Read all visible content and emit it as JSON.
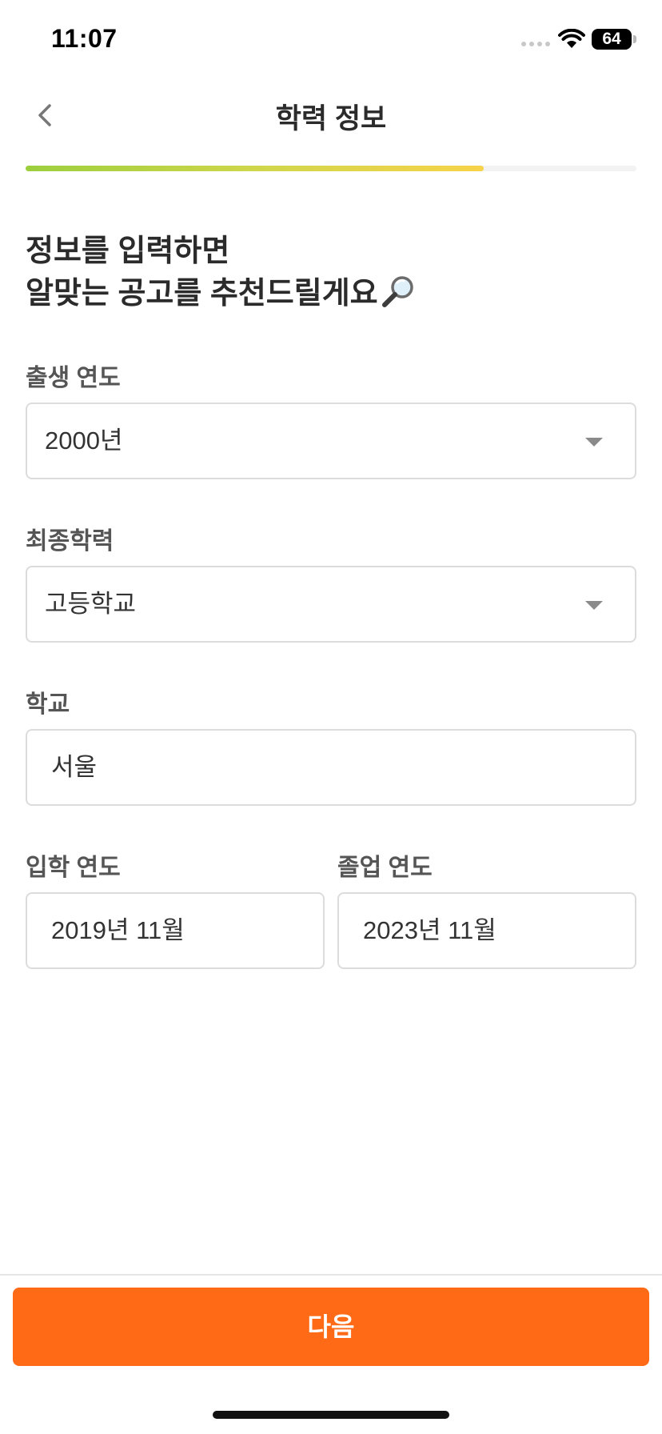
{
  "status_bar": {
    "time": "11:07",
    "battery": "64",
    "icons": [
      "signal-dots-icon",
      "wifi-icon",
      "battery-icon"
    ]
  },
  "nav": {
    "title": "학력 정보",
    "back_icon": "chevron-left-icon"
  },
  "progress": {
    "fraction": 0.75,
    "colors": [
      "#9ccf3d",
      "#f7d349"
    ]
  },
  "heading": {
    "line1": "정보를 입력하면",
    "line2": "알맞는 공고를 추천드릴게요",
    "emoji_icon": "magnifying-glass-icon"
  },
  "form": {
    "birth_year": {
      "label": "출생 연도",
      "value": "2000년"
    },
    "education": {
      "label": "최종학력",
      "value": "고등학교"
    },
    "school": {
      "label": "학교",
      "value": "서울"
    },
    "admission": {
      "label": "입학 연도",
      "value": "2019년 11월"
    },
    "graduation": {
      "label": "졸업 연도",
      "value": "2023년 11월"
    }
  },
  "footer": {
    "next_label": "다음",
    "accent_color": "#ff6a17"
  }
}
